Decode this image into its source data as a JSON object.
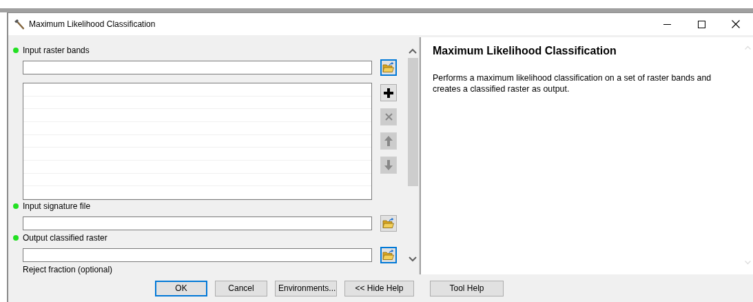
{
  "window": {
    "title": "Maximum Likelihood Classification"
  },
  "parameters": [
    {
      "kind": "list",
      "label": "Input raster bands",
      "required": true,
      "browse_focused": true,
      "list_buttons": [
        {
          "kind": "add",
          "disabled": false
        },
        {
          "kind": "remove",
          "disabled": true
        },
        {
          "kind": "up",
          "disabled": true
        },
        {
          "kind": "down",
          "disabled": true
        }
      ]
    },
    {
      "kind": "file",
      "label": "Input signature file",
      "required": true,
      "browse_focused": false
    },
    {
      "kind": "file",
      "label": "Output classified raster",
      "required": true,
      "browse_focused": true
    },
    {
      "kind": "label",
      "label": "Reject fraction (optional)",
      "required": false
    }
  ],
  "help": {
    "title": "Maximum Likelihood Classification",
    "description": "Performs a maximum likelihood classification on a set of raster bands and creates a classified raster as output."
  },
  "buttons": [
    {
      "label": "OK",
      "default": true
    },
    {
      "label": "Cancel",
      "default": false
    },
    {
      "label": "Environments...",
      "default": false
    },
    {
      "label": "<< Hide Help",
      "default": false
    }
  ],
  "tool_help": {
    "label": "Tool Help"
  }
}
